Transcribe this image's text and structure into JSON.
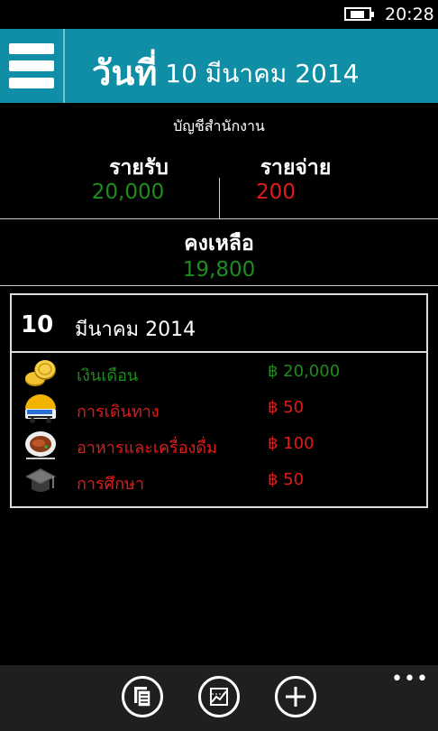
{
  "status": {
    "time": "20:28"
  },
  "header": {
    "title_prefix": "วันที่",
    "title_date": "10 มีนาคม 2014"
  },
  "summary": {
    "account": "บัญชีสำนักงาน",
    "income_label": "รายรับ",
    "income_value": "20,000",
    "expense_label": "รายจ่าย",
    "expense_value": "200",
    "balance_label": "คงเหลือ",
    "balance_value": "19,800"
  },
  "day_card": {
    "day": "10",
    "month_year": "มีนาคม 2014",
    "entries": [
      {
        "icon": "coins-icon",
        "category": "เงินเดือน",
        "amount": "฿ 20,000",
        "type": "income"
      },
      {
        "icon": "bus-icon",
        "category": "การเดินทาง",
        "amount": "฿ 50",
        "type": "expense"
      },
      {
        "icon": "food-plate-icon",
        "category": "อาหารและเครื่องดื่ม",
        "amount": "฿ 100",
        "type": "expense"
      },
      {
        "icon": "graduation-cap-icon",
        "category": "การศึกษา",
        "amount": "฿ 50",
        "type": "expense"
      }
    ]
  },
  "appbar": {
    "more": "•••"
  },
  "colors": {
    "header": "#0f8ea6",
    "income": "#1e8c1e",
    "expense": "#e01b1b"
  }
}
